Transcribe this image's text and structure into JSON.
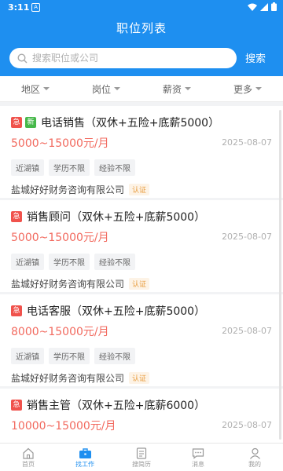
{
  "status": {
    "time": "3:11",
    "notif_glyph": "A"
  },
  "header": {
    "title": "职位列表"
  },
  "search": {
    "placeholder": "搜索职位或公司",
    "button_label": "搜索"
  },
  "filters": [
    "地区",
    "岗位",
    "薪资",
    "更多"
  ],
  "jobs": [
    {
      "title": "电话销售（双休+五险+底薪5000）",
      "salary": "5000~15000元/月",
      "date": "2025-08-07",
      "tags": [
        "近湖镇",
        "学历不限",
        "经验不限"
      ],
      "company": "盐城好好财务咨询有限公司",
      "verified": "认证",
      "urgent_badge": "急",
      "new_badge": "新"
    },
    {
      "title": "销售顾问（双休+五险+底薪5000）",
      "salary": "5000~15000元/月",
      "date": "2025-08-07",
      "tags": [
        "近湖镇",
        "学历不限",
        "经验不限"
      ],
      "company": "盐城好好财务咨询有限公司",
      "verified": "认证",
      "urgent_badge": "急"
    },
    {
      "title": "电话客服（双休+五险+底薪5000）",
      "salary": "8000~15000元/月",
      "date": "2025-08-07",
      "tags": [
        "近湖镇",
        "学历不限",
        "经验不限"
      ],
      "company": "盐城好好财务咨询有限公司",
      "verified": "认证",
      "urgent_badge": "急"
    },
    {
      "title": "销售主管（双休+五险+底薪6000）",
      "salary": "10000~15000元/月",
      "date": "2025-08-07",
      "urgent_badge": "急"
    }
  ],
  "tabs": [
    {
      "label": "首页",
      "icon": "home-icon"
    },
    {
      "label": "找工作",
      "icon": "briefcase-icon",
      "active": true
    },
    {
      "label": "搜简历",
      "icon": "document-icon"
    },
    {
      "label": "消息",
      "icon": "chat-icon"
    },
    {
      "label": "我的",
      "icon": "user-icon"
    }
  ],
  "colors": {
    "primary": "#1e8ff0",
    "salary": "#f26a5f",
    "urgent": "#f0524c",
    "new": "#46b84a",
    "verify": "#e89b3c"
  }
}
